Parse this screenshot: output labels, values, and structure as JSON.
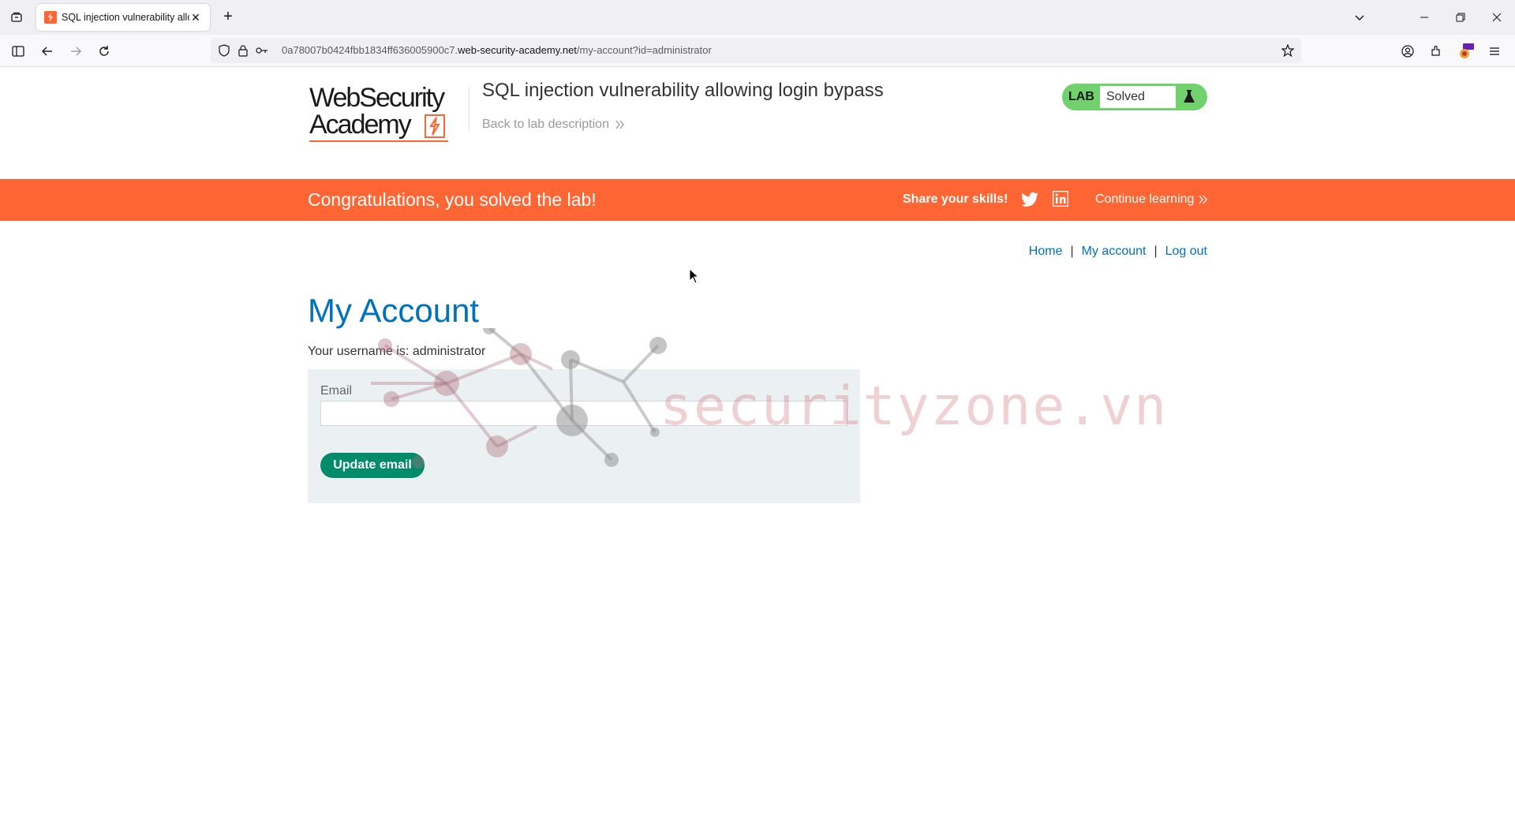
{
  "browser": {
    "tab_title": "SQL injection vulnerability allow",
    "tab_close": "✕",
    "new_tab": "+",
    "url_prefix": "0a78007b0424fbb1834ff636005900c7.",
    "url_domain": "web-security-academy.net",
    "url_path": "/my-account?id=administrator"
  },
  "header": {
    "logo_line1": "WebSecurity",
    "logo_line2": "Academy",
    "lab_title": "SQL injection vulnerability allowing login bypass",
    "back_link": "Back to lab description",
    "lab_badge_label": "LAB",
    "lab_status": "Solved"
  },
  "banner": {
    "message": "Congratulations, you solved the lab!",
    "share": "Share your skills!",
    "continue": "Continue learning"
  },
  "nav": {
    "home": "Home",
    "sep1": "|",
    "my_account": "My account",
    "sep2": "|",
    "log_out": "Log out"
  },
  "main": {
    "title": "My Account",
    "username_prefix": "Your username is: ",
    "username": "administrator",
    "email_label": "Email",
    "email_value": "",
    "update_button": "Update email"
  },
  "watermark": {
    "text": "securityzone.vn"
  },
  "colors": {
    "accent_orange": "#ff6633",
    "link_blue": "#0071bc",
    "lab_green": "#70d16d",
    "button_green": "#008b6b"
  }
}
